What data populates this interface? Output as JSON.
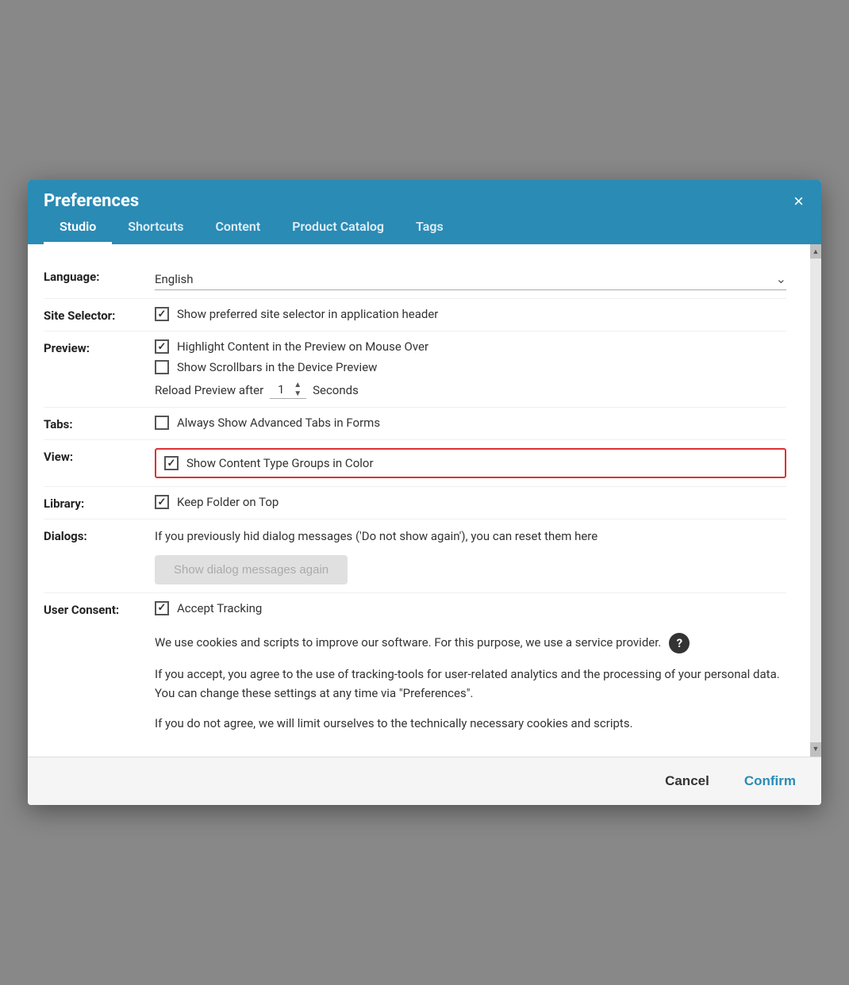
{
  "dialog": {
    "title": "Preferences",
    "close_label": "×"
  },
  "tabs": [
    {
      "id": "studio",
      "label": "Studio",
      "active": true
    },
    {
      "id": "shortcuts",
      "label": "Shortcuts",
      "active": false
    },
    {
      "id": "content",
      "label": "Content",
      "active": false
    },
    {
      "id": "product-catalog",
      "label": "Product Catalog",
      "active": false
    },
    {
      "id": "tags",
      "label": "Tags",
      "active": false
    }
  ],
  "form": {
    "language": {
      "label": "Language:",
      "value": "English",
      "chevron": "⌄"
    },
    "site_selector": {
      "label": "Site Selector:",
      "checkbox_checked": true,
      "checkbox_label": "Show preferred site selector in application header"
    },
    "preview": {
      "label": "Preview:",
      "highlight_checked": true,
      "highlight_label": "Highlight Content in the Preview on Mouse Over",
      "scrollbars_checked": false,
      "scrollbars_label": "Show Scrollbars in the Device Preview",
      "reload_label": "Reload Preview after",
      "reload_value": "1",
      "reload_seconds": "Seconds"
    },
    "tabs_section": {
      "label": "Tabs:",
      "checkbox_checked": false,
      "checkbox_label": "Always Show Advanced Tabs in Forms"
    },
    "view": {
      "label": "View:",
      "checkbox_checked": true,
      "checkbox_label": "Show Content Type Groups in Color"
    },
    "library": {
      "label": "Library:",
      "checkbox_checked": true,
      "checkbox_label": "Keep Folder on Top"
    },
    "dialogs": {
      "label": "Dialogs:",
      "description": "If you previously hid dialog messages ('Do not show again'), you can reset them here",
      "button_label": "Show dialog messages again"
    },
    "user_consent": {
      "label": "User Consent:",
      "checkbox_checked": true,
      "checkbox_label": "Accept Tracking",
      "text1": "We use cookies and scripts to improve our software. For this purpose, we use a service provider.",
      "text2": "If you accept, you agree to the use of tracking-tools for user-related analytics and the processing of your personal data. You can change these settings at any time via \"Preferences\".",
      "text3": "If you do not agree, we will limit ourselves to the technically necessary cookies and scripts."
    }
  },
  "footer": {
    "cancel_label": "Cancel",
    "confirm_label": "Confirm"
  }
}
